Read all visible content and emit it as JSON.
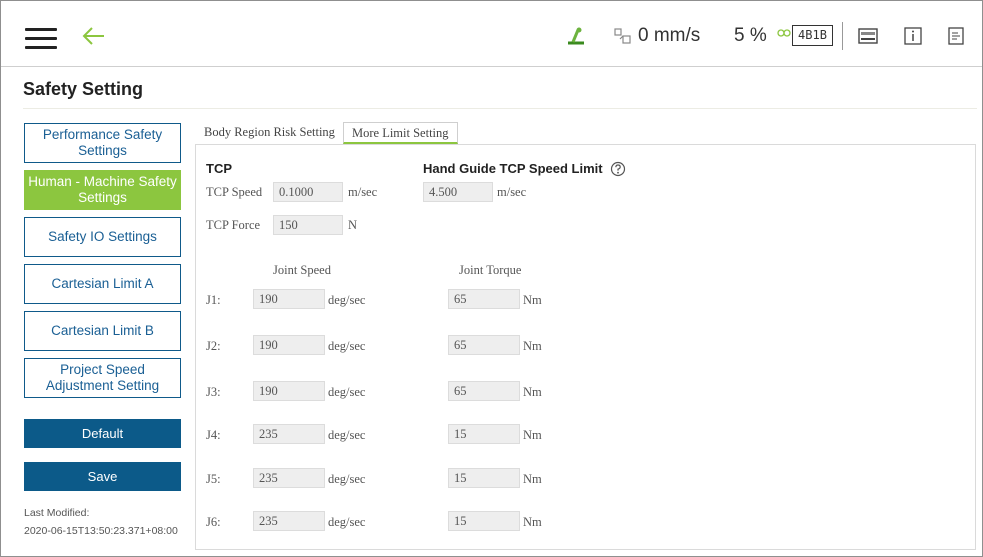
{
  "header": {
    "speed": "0 mm/s",
    "speed_ratio": "5 %",
    "mode_badge": "4B1B",
    "colors": {
      "accent": "#8cc63f",
      "primary": "#0c5a89"
    },
    "icons": [
      "hamburger-menu-icon",
      "back-arrow-icon",
      "robot-status-icon",
      "speed-icon",
      "link-icon",
      "keyboard-icon",
      "info-icon",
      "log-icon"
    ]
  },
  "page": {
    "title": "Safety Setting"
  },
  "sidebar": {
    "items": [
      {
        "label": "Performance Safety Settings",
        "active": false
      },
      {
        "label": "Human - Machine Safety Settings",
        "active": true
      },
      {
        "label": "Safety IO Settings",
        "active": false
      },
      {
        "label": "Cartesian Limit A",
        "active": false
      },
      {
        "label": "Cartesian Limit B",
        "active": false
      },
      {
        "label": "Project Speed Adjustment Setting",
        "active": false
      }
    ],
    "default_label": "Default",
    "save_label": "Save",
    "last_modified_label": "Last Modified:",
    "last_modified_value": "2020-06-15T13:50:23.371+08:00"
  },
  "tabs": [
    {
      "label": "Body Region Risk Setting",
      "active": false
    },
    {
      "label": "More Limit Setting",
      "active": true
    }
  ],
  "tcp": {
    "heading": "TCP",
    "speed_label": "TCP Speed",
    "speed_value": "0.1000",
    "speed_unit": "m/sec",
    "force_label": "TCP Force",
    "force_value": "150",
    "force_unit": "N"
  },
  "hand_guide": {
    "heading": "Hand Guide TCP Speed Limit",
    "value": "4.500",
    "unit": "m/sec"
  },
  "joints": {
    "speed_header": "Joint Speed",
    "torque_header": "Joint Torque",
    "speed_unit": "deg/sec",
    "torque_unit": "Nm",
    "rows": [
      {
        "label": "J1:",
        "speed": "190",
        "torque": "65"
      },
      {
        "label": "J2:",
        "speed": "190",
        "torque": "65"
      },
      {
        "label": "J3:",
        "speed": "190",
        "torque": "65"
      },
      {
        "label": "J4:",
        "speed": "235",
        "torque": "15"
      },
      {
        "label": "J5:",
        "speed": "235",
        "torque": "15"
      },
      {
        "label": "J6:",
        "speed": "235",
        "torque": "15"
      }
    ]
  }
}
